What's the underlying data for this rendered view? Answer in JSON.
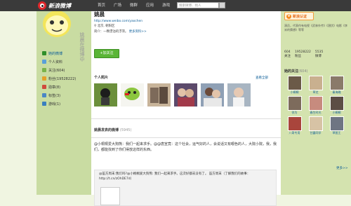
{
  "topbar": {
    "logo_text": "新浪微博",
    "logo_sub": "weibo.com",
    "nav": [
      "首页",
      "广场",
      "微群",
      "应用",
      "游戏"
    ],
    "search_placeholder": "搜索微博、找人",
    "user": "小桥流水人家  ",
    "right_links": "设置 | 帮助 | 退出"
  },
  "sidebar": {
    "vertical_text": "姚晨在微博中",
    "menu": [
      {
        "label": "她的微博",
        "icon": "home-icon",
        "color": "#2f8f2a"
      },
      {
        "label": "个人资料",
        "icon": "profile-icon",
        "color": "#5aa0d9"
      },
      {
        "label": "关注(604)",
        "icon": "follow-icon",
        "color": "#7ab34a"
      },
      {
        "label": "粉丝(19528222)",
        "icon": "fans-icon",
        "color": "#e3a22a"
      },
      {
        "label": "勋章(8)",
        "icon": "medal-icon",
        "color": "#d04a3d"
      },
      {
        "label": "标签(3)",
        "icon": "tag-icon",
        "color": "#4a86c5"
      },
      {
        "label": "游戏(1)",
        "icon": "game-icon",
        "color": "#3a7fbf"
      }
    ]
  },
  "profile": {
    "name": "姚晨",
    "url": "http://www.weibo.com/yaochen",
    "location": "北京, 朝阳区",
    "bio_label": "简介：",
    "bio": "一颗漂泊的浮萍。",
    "bio_link": "更多资料>>",
    "follow_button": "+加关注",
    "photos_title": "个人照片",
    "photos_more": "查看全部",
    "posts_title": "姚晨发表的微博",
    "posts_count": "(5945)"
  },
  "post": {
    "text": "@小桐桐爱大狗熊：我们一起来求手。@@唐宣竟：这个社会，运气好的人，会说话又有眼色的人，大院小院，我，我们，都能找到了你们得放这样的东西。",
    "quote_text": "@笛方周末:我们吗?@小桐桐爱大狗熊: 我们一起来求手。这次好都去没有了。 笛方周末（了解我们的故事：http://t.cn/zOhDE7d）"
  },
  "right": {
    "verified": "新浪认证",
    "desc": "演员，代表作有电视《武林外传》《潜伏》电影《李米的猜想》等等",
    "stats": [
      {
        "num": "604",
        "label": "关注"
      },
      {
        "num": "19528222",
        "label": "粉丝"
      },
      {
        "num": "5535",
        "label": "微博"
      }
    ],
    "follows_title": "她的关注",
    "follows_count": "(604)",
    "follows": [
      {
        "name": "小桐桐",
        "color": "#6b5a48"
      },
      {
        "name": "草芝",
        "color": "#c9b08f"
      },
      {
        "name": "秦海璐",
        "color": "#8a7a6a"
      },
      {
        "name": "徐为",
        "color": "#7d6b5c"
      },
      {
        "name": "春生时光",
        "color": "#c78b7e"
      },
      {
        "name": "小桐桐",
        "color": "#5c4d45"
      },
      {
        "name": "八哥专用",
        "color": "#a9453c"
      },
      {
        "name": "甘露同学",
        "color": "#d7c3a5"
      },
      {
        "name": "草图王",
        "color": "#6f7583"
      }
    ],
    "more": "更多>>"
  },
  "colors": {
    "accent_green": "#5ab536",
    "link_blue": "#0a5c97",
    "sidebar_bg": "#c9dca2",
    "right_bg": "#d4e3af"
  }
}
